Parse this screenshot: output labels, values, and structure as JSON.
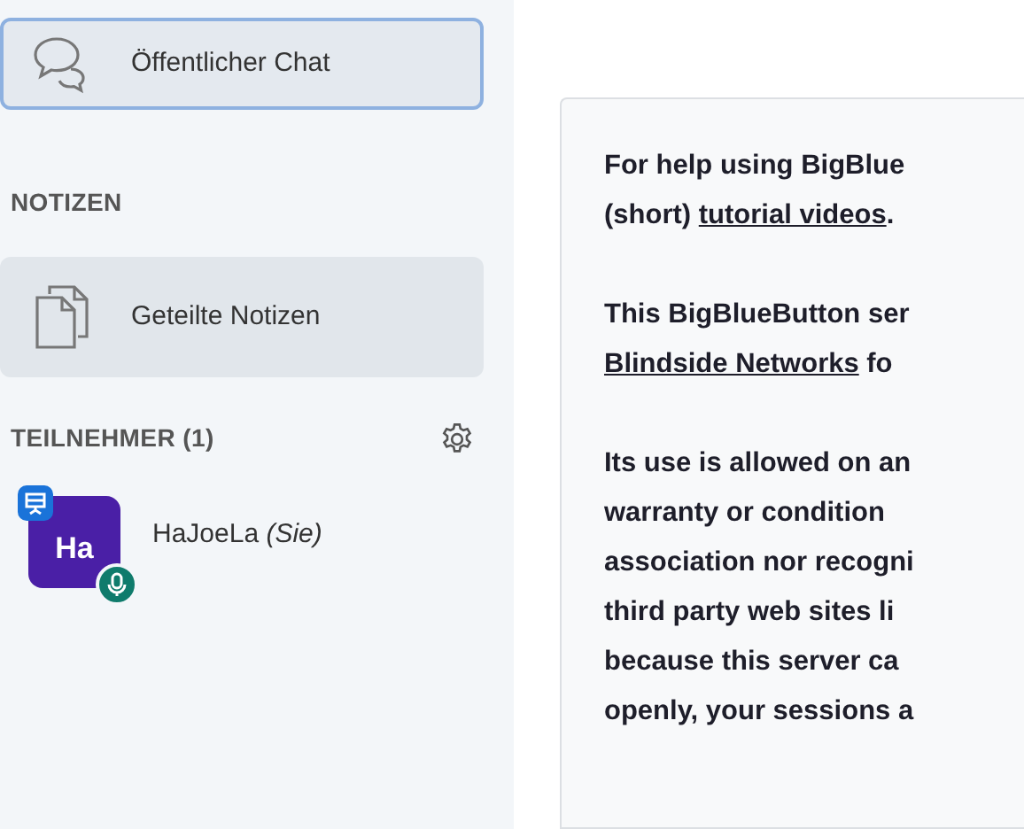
{
  "sidebar": {
    "chat_items": [
      {
        "label": "Öffentlicher Chat",
        "selected": true
      }
    ],
    "notes_heading": "NOTIZEN",
    "notes_items": [
      {
        "label": "Geteilte Notizen",
        "selected": false
      }
    ],
    "participants_heading": "TEILNEHMER (1)",
    "participants": [
      {
        "initials": "Ha",
        "name": "HaJoeLa",
        "you_label": "(Sie)",
        "color": "#4a1fa6",
        "presenter": true,
        "voice": true
      }
    ]
  },
  "main": {
    "paragraphs": [
      [
        [
          {
            "text": "For help using BigBlue",
            "link": false
          }
        ],
        [
          {
            "text": "(short) ",
            "link": false
          },
          {
            "text": "tutorial videos",
            "link": true
          },
          {
            "text": ".",
            "link": false
          }
        ]
      ],
      [
        [
          {
            "text": "This BigBlueButton ser",
            "link": false
          }
        ],
        [
          {
            "text": "Blindside Networks",
            "link": true
          },
          {
            "text": " fo",
            "link": false
          }
        ]
      ],
      [
        [
          {
            "text": "Its use is allowed on an",
            "link": false
          }
        ],
        [
          {
            "text": "warranty or condition",
            "link": false
          }
        ],
        [
          {
            "text": "association nor recogni",
            "link": false
          }
        ],
        [
          {
            "text": "third party web sites li",
            "link": false
          }
        ],
        [
          {
            "text": "because this server ca",
            "link": false
          }
        ],
        [
          {
            "text": "openly, your sessions a",
            "link": false
          }
        ]
      ]
    ]
  }
}
